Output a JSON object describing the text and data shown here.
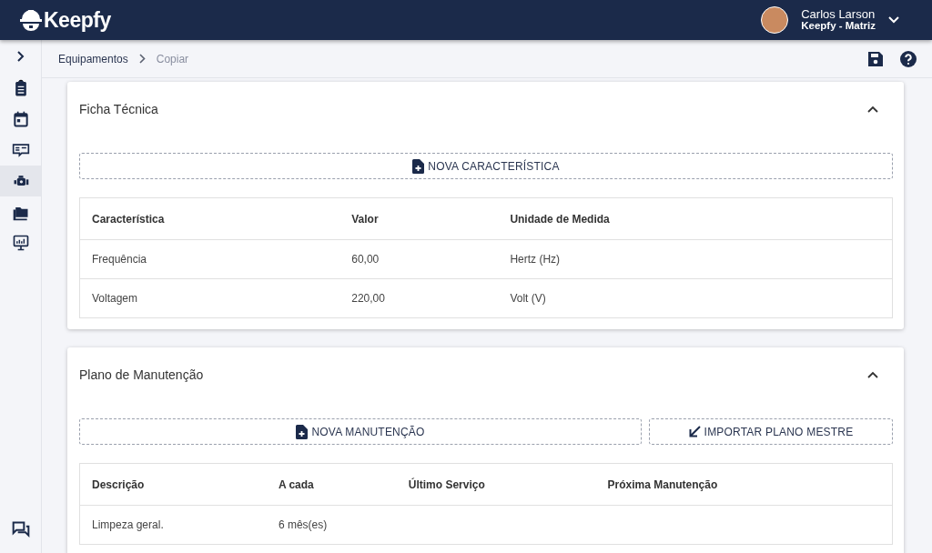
{
  "header": {
    "logo": "Keepfy",
    "user": {
      "name": "Carlos Larson",
      "company": "Keepfy - Matriz"
    }
  },
  "sidebar": {
    "items": [
      {
        "selected": false
      },
      {
        "selected": false
      },
      {
        "selected": false
      },
      {
        "selected": true
      },
      {
        "selected": false
      },
      {
        "selected": false
      }
    ]
  },
  "breadcrumb": [
    "Equipamentos",
    "Copiar"
  ],
  "sections": [
    {
      "title": "Ficha Técnica",
      "expanded": true,
      "buttons": [
        {
          "kind": "new",
          "label": "NOVA CARACTERÍSTICA"
        }
      ],
      "table": {
        "columns": [
          "Característica",
          "Valor",
          "Unidade de Medida"
        ],
        "rows": [
          [
            "Frequência",
            "60,00",
            "Hertz (Hz)"
          ],
          [
            "Voltagem",
            "220,00",
            "Volt (V)"
          ]
        ]
      }
    },
    {
      "title": "Plano de Manutenção",
      "expanded": true,
      "buttons": [
        {
          "kind": "new",
          "label": "NOVA MANUTENÇÃO"
        },
        {
          "kind": "import",
          "label": "IMPORTAR PLANO MESTRE"
        }
      ],
      "table": {
        "columns": [
          "Descrição",
          "A cada",
          "Último Serviço",
          "Próxima Manutenção"
        ],
        "rows": [
          [
            "Limpeza geral.",
            "6 mês(es)",
            "",
            ""
          ]
        ]
      }
    }
  ]
}
